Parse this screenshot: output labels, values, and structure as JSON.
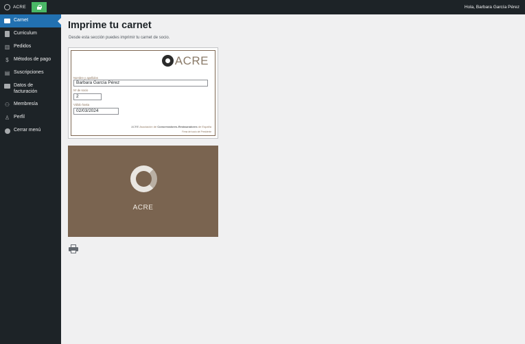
{
  "adminbar": {
    "site_name": "ACRE",
    "greeting": "Hola, Barbara García Pérez"
  },
  "sidebar": {
    "items": [
      {
        "label": "Carnet",
        "icon": "card-icon",
        "active": true
      },
      {
        "label": "Curriculum",
        "icon": "document-icon"
      },
      {
        "label": "Pedidos",
        "icon": "chart-icon"
      },
      {
        "label": "Métodos de pago",
        "icon": "money-icon"
      },
      {
        "label": "Suscripciones",
        "icon": "list-icon"
      },
      {
        "label": "Datos de facturación",
        "icon": "card-icon"
      },
      {
        "label": "Membresía",
        "icon": "group-icon"
      },
      {
        "label": "Perfil",
        "icon": "user-icon"
      },
      {
        "label": "Cerrar menú",
        "icon": "collapse-icon"
      }
    ]
  },
  "main": {
    "title": "Imprime tu carnet",
    "description": "Desde esta sección puedes imprimir tu carnet de socio."
  },
  "card": {
    "logo_text": "ACRE",
    "name_label": "Nombre y apellidos",
    "name_value": "Barbara García Pérez",
    "number_label": "Nº de socio",
    "number_value": "2",
    "date_label": "Válido hasta",
    "date_value": "02/03/2024",
    "footer_prefix": "ACRE",
    "footer_mid": "Asociación de",
    "footer_bold": "Conservadores-Restauradores",
    "footer_suffix": "de España",
    "footer_small": "Firma del socio del Presidente"
  },
  "card_back": {
    "logo_text": "ACRE"
  },
  "colors": {
    "accent": "#2271b1",
    "sidebar_bg": "#1d2327",
    "card_brown": "#7a6450"
  }
}
